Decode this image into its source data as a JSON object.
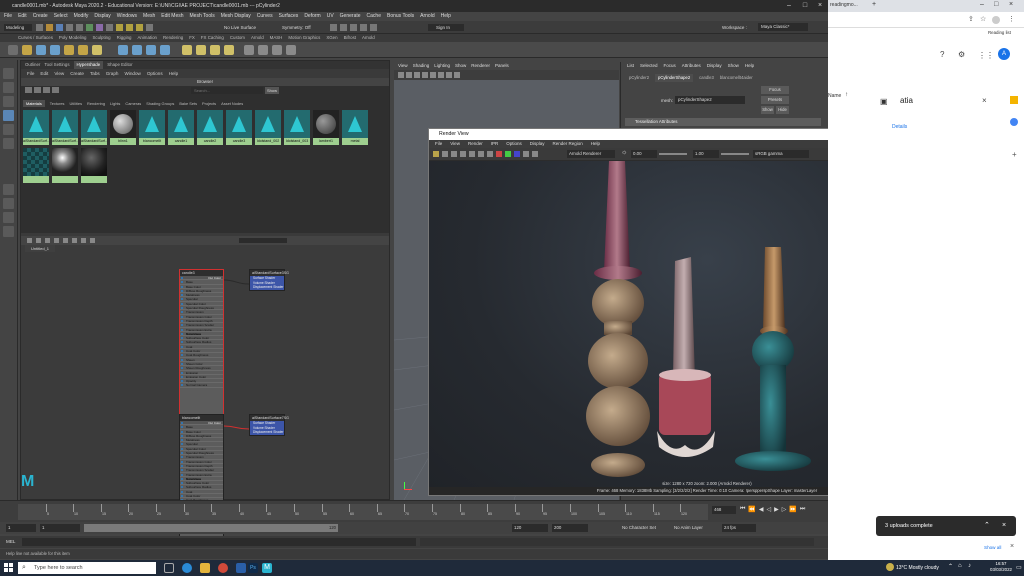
{
  "maya": {
    "title": "candle0001.mb* - Autodesk Maya 2020.2 - Educational Version: E:\\UNI\\CGI\\AE PROJECT\\candle0001.mb --- pCylinder2",
    "menu": [
      "File",
      "Edit",
      "Create",
      "Select",
      "Modify",
      "Display",
      "Windows",
      "Mesh",
      "Edit Mesh",
      "Mesh Tools",
      "Mesh Display",
      "Curves",
      "Surfaces",
      "Deform",
      "UV",
      "Generate",
      "Cache",
      "Bonus Tools",
      "Arnold",
      "Help"
    ],
    "workspace_label": "Workspace :",
    "workspace_value": "Maya Classic*",
    "mode": "Modeling",
    "no_live_surface": "No Live Surface",
    "symmetry": "Symmetry: Off",
    "sign_in": "Sign In",
    "shelf_tabs": [
      "Curves / Surfaces",
      "Poly Modeling",
      "Sculpting",
      "Rigging",
      "Animation",
      "Rendering",
      "FX",
      "FX Caching",
      "Custom",
      "Arnold",
      "MASH",
      "Motion Graphics",
      "XGen",
      "Bifrost",
      "Arnold"
    ],
    "hypershade": {
      "tabs": [
        "Outliner",
        "Tool Settings",
        "Hypershade",
        "Shape Editor"
      ],
      "menu": [
        "File",
        "Edit",
        "View",
        "Create",
        "Tabs",
        "Graph",
        "Window",
        "Options",
        "Help"
      ],
      "browser_label": "Browser",
      "categories": [
        "Materials",
        "Textures",
        "Utilities",
        "Rendering",
        "Lights",
        "Cameras",
        "Shading Groups",
        "Bake Sets",
        "Projects",
        "Asset Nodes"
      ],
      "show_label": "Show",
      "search_placeholder": "Search...",
      "materials_row1": [
        "aiStandardSurf...",
        "aiStandardSurf...",
        "aiStandardSurf...",
        "blinn1",
        "blancomellt",
        "candle1",
        "candle2",
        "candle3",
        "Idolstand_002",
        "Idolstand_003",
        "lambert1",
        "metal"
      ],
      "materials_row2": [
        "",
        "",
        ""
      ],
      "graph_tab": "Untitled_1",
      "node1": {
        "title": "candle3",
        "tag": "Out Color",
        "attrs": [
          "Base",
          "Base Color",
          "Diffuse Roughness",
          "Metalness",
          "Specular",
          "Specular Color",
          "Specular Roughness",
          "Transmission",
          "Transmission Color",
          "Transmission Depth",
          "Transmission Scatter",
          "Transmission Extra Roughness",
          "Subsurface",
          "Subsurface Color",
          "Subsurface Radius",
          "Coat",
          "Coat Color",
          "Coat Roughness",
          "Sheen",
          "Sheen Color",
          "Sheen Roughness",
          "Emission",
          "Emission Color",
          "Opacity",
          "Normal Camera"
        ]
      },
      "node2": {
        "title": "blancomellt",
        "tag": "Out Color",
        "attrs": [
          "Base",
          "Base Color",
          "Diffuse Roughness",
          "Metalness",
          "Specular",
          "Specular Color",
          "Specular Roughness",
          "Transmission",
          "Transmission Color",
          "Transmission Depth",
          "Transmission Scatter",
          "Transmission Extra Roughness",
          "Subsurface",
          "Subsurface Color",
          "Subsurface Radius",
          "Coat",
          "Coat Color",
          "Coat Roughness",
          "Sheen",
          "Sheen Color",
          "Sheen Roughness",
          "Emission",
          "Emission Color",
          "Opacity",
          "Normal Camera"
        ]
      },
      "sg1": {
        "title": "aiStandardSurface3SG",
        "rows": [
          "Surface Shader",
          "Volume Shader",
          "Displacement Shader"
        ]
      },
      "sg2": {
        "title": "aiStandardSurface7SG",
        "rows": [
          "Surface Shader",
          "Volume Shader",
          "Displacement Shader"
        ]
      }
    },
    "viewport_menu": [
      "View",
      "Shading",
      "Lighting",
      "Show",
      "Renderer",
      "Panels"
    ],
    "attr_editor": {
      "menu": [
        "List",
        "Selected",
        "Focus",
        "Attributes",
        "Display",
        "Show",
        "Help"
      ],
      "tabs": [
        "pCylinder2",
        "pCylinderShape2",
        "candle3",
        "blancomellt4aider"
      ],
      "mesh_label": "mesh:",
      "mesh_value": "pCylinderShape2",
      "focus": "Focus",
      "presets": "Presets",
      "show": "Show",
      "hide": "Hide",
      "section": "Tessellation Attributes"
    },
    "render_view": {
      "title": "Render View",
      "menu": [
        "File",
        "View",
        "Render",
        "IPR",
        "Options",
        "Display",
        "Render Region",
        "Help"
      ],
      "renderer": "Arnold Renderer",
      "exposure": "0.00",
      "gamma": "1.00",
      "view_transform": "sRGB gamma",
      "zoom": "1:1 (250)",
      "size_line": "size: 1280 x 720  zoom: 2.000    (Arnold Renderer)",
      "status": "Frame: 468    Memory: 1838Mb    Sampling: [3/2/2/2/2]    Render Time: 0:10    Camera: !perspperspShape    Layer: masterLayer"
    },
    "timeline": {
      "ticks": [
        "5",
        "10",
        "15",
        "20",
        "25",
        "30",
        "35",
        "40",
        "45",
        "50",
        "55",
        "60",
        "65",
        "70",
        "75",
        "80",
        "85",
        "90",
        "95",
        "100",
        "105",
        "110",
        "115",
        "120"
      ],
      "current_frame": "468"
    },
    "range": {
      "start": "1",
      "start2": "1",
      "end_inner": "120",
      "end_inner2": "120",
      "end": "200",
      "no_char_set": "No Character Set",
      "no_anim_layer": "No Anim Layer",
      "fps": "24 fps"
    },
    "cmd": {
      "label": "MEL"
    },
    "help": "Help line not available for this item"
  },
  "chrome": {
    "reading_list": "Reading list",
    "tab_text": "readingmo...",
    "name_header": "Name",
    "search_panel_text": "atia",
    "details": "Details",
    "show_all": "Show all"
  },
  "toast": {
    "text": "3 uploads complete"
  },
  "taskbar": {
    "search_placeholder": "Type here to search",
    "weather": "13°C  Mostly cloudy",
    "time": "16:57",
    "date": "03/03/2022"
  },
  "colors": {
    "maya_bg": "#444444",
    "material_label_bg": "#9ecf8f",
    "wedge_cyan": "#2ec7d2",
    "node_red_outline": "#d23030",
    "shading_group_blue": "#3c55a8",
    "taskbar": "#1f2a3a"
  }
}
